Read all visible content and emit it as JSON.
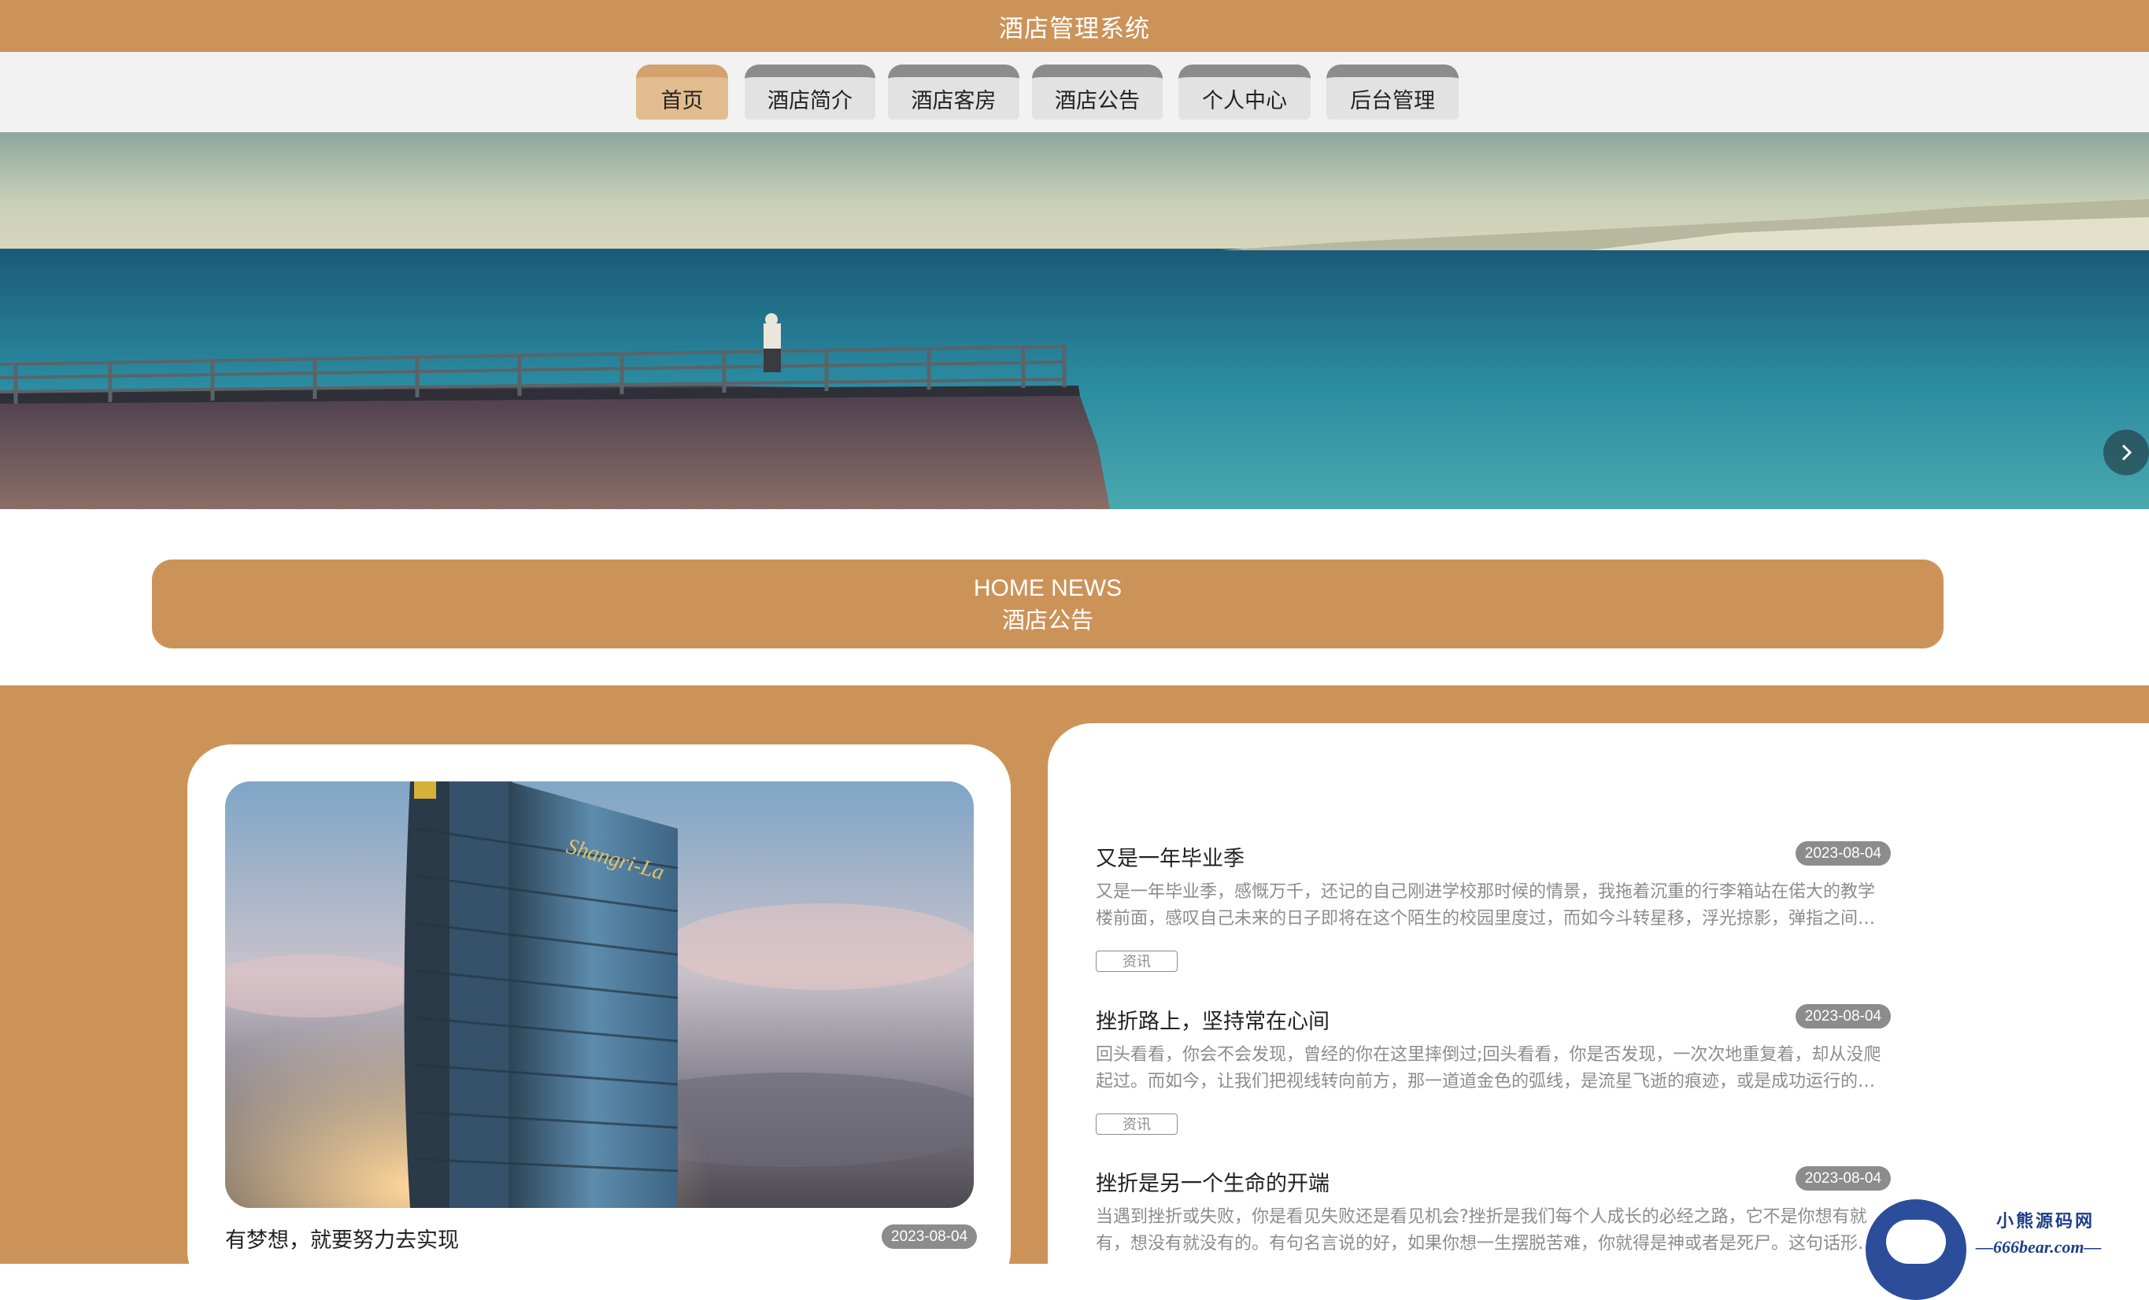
{
  "site": {
    "title": "酒店管理系统"
  },
  "nav": {
    "items": [
      {
        "label": "首页",
        "active": true
      },
      {
        "label": "酒店简介",
        "active": false
      },
      {
        "label": "酒店客房",
        "active": false
      },
      {
        "label": "酒店公告",
        "active": false
      },
      {
        "label": "个人中心",
        "active": false
      },
      {
        "label": "后台管理",
        "active": false
      }
    ]
  },
  "banner": {
    "next_icon": "chevron-right-icon"
  },
  "news_header": {
    "en": "HOME NEWS",
    "zh": "酒店公告"
  },
  "featured": {
    "title": "有梦想，就要努力去实现",
    "date": "2023-08-04",
    "image_sign": "Shangri-La"
  },
  "news_list": [
    {
      "title": "又是一年毕业季",
      "date": "2023-08-04",
      "excerpt": "又是一年毕业季，感慨万千，还记的自己刚进学校那时候的情景，我拖着沉重的行李箱站在偌大的教学楼前面，感叹自己未来的日子即将在这个陌生的校园里度过，而如今斗转星移，浮光掠影，弹指之间，我们即将告别这个熟悉的校园",
      "tag": "资讯"
    },
    {
      "title": "挫折路上，坚持常在心间",
      "date": "2023-08-04",
      "excerpt": "回头看看，你会不会发现，曾经的你在这里摔倒过;回头看看，你是否发现，一次次地重复着，却从没爬起过。而如今，让我们把视线转向前方，那一道道金色的弧线，是流星飞逝的痕迹，或是成功运行的轨迹",
      "tag": "资讯"
    },
    {
      "title": "挫折是另一个生命的开端",
      "date": "2023-08-04",
      "excerpt": "当遇到挫折或失败，你是看见失败还是看见机会?挫折是我们每个人成长的必经之路，它不是你想有就有，想没有就没有的。有句名言说的好，如果你想一生摆脱苦难，你就得是神或者是死尸。这句话形象地说明了挫折是不可避免的",
      "tag": "资讯"
    }
  ],
  "watermark": {
    "brand": "小熊源码网",
    "url": "—666bear.com—"
  },
  "colors": {
    "accent": "#cc9359",
    "active_tab": "#e2bc8e",
    "badge": "#8c8c8c"
  }
}
